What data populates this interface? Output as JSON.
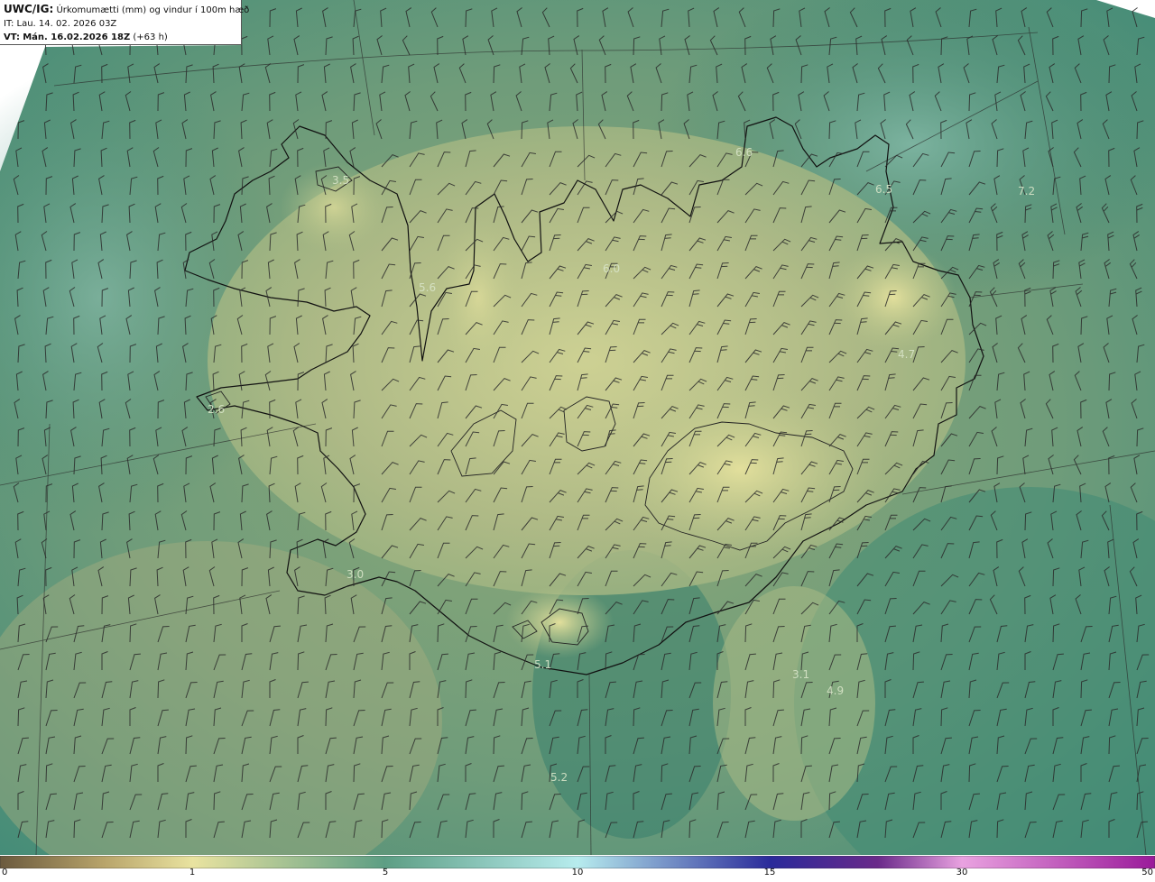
{
  "header": {
    "model": "UWC/IG:",
    "title": "Úrkomumætti (mm) og vindur í 100m hæð",
    "it_label": "IT:",
    "it_value": "Lau. 14. 02. 2026 03Z",
    "vt_label": "VT:",
    "vt_value": "Mán. 16.02.2026 18Z",
    "lead": "(+63 h)"
  },
  "colorbar": {
    "ticks": [
      "0",
      "1",
      "5",
      "10",
      "15",
      "30",
      "50"
    ],
    "colors": [
      "#6b5a3e",
      "#b8a46a",
      "#e9e3a0",
      "#5d9e84",
      "#b7ecee",
      "#2a2a9a",
      "#6a2a8a",
      "#e9a2e0",
      "#9a1a9a"
    ]
  },
  "map_labels": [
    {
      "text": "3.5",
      "name": "label-westfjords"
    },
    {
      "text": "5.6",
      "name": "label-northwest"
    },
    {
      "text": "6.0",
      "name": "label-north-central"
    },
    {
      "text": "6.6",
      "name": "label-northeast-coast"
    },
    {
      "text": "6.5",
      "name": "label-langanes"
    },
    {
      "text": "7.2",
      "name": "label-ne-sea"
    },
    {
      "text": "4.7",
      "name": "label-east"
    },
    {
      "text": "2.6",
      "name": "label-snaefellsnes"
    },
    {
      "text": "3.0",
      "name": "label-reykjanes"
    },
    {
      "text": "5.1",
      "name": "label-south-coast"
    },
    {
      "text": "3.1",
      "name": "label-southeast-sea"
    },
    {
      "text": "4.9",
      "name": "label-southeast-sea-2"
    },
    {
      "text": "5.2",
      "name": "label-south-sea"
    }
  ]
}
